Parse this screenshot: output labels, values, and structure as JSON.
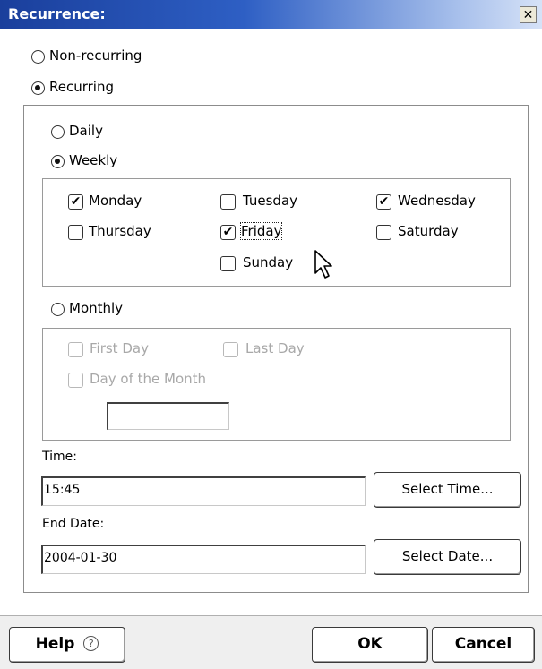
{
  "dialog": {
    "title": "Recurrence:",
    "close_glyph": "✕"
  },
  "recurrence": {
    "non_recurring_label": "Non-recurring",
    "recurring_label": "Recurring",
    "selected": "Recurring"
  },
  "frequency": {
    "daily_label": "Daily",
    "weekly_label": "Weekly",
    "monthly_label": "Monthly",
    "selected": "Weekly"
  },
  "weekly_days": {
    "monday": {
      "label": "Monday",
      "checked": true
    },
    "tuesday": {
      "label": "Tuesday",
      "checked": false
    },
    "wednesday": {
      "label": "Wednesday",
      "checked": true
    },
    "thursday": {
      "label": "Thursday",
      "checked": false
    },
    "friday": {
      "label": "Friday",
      "checked": true
    },
    "saturday": {
      "label": "Saturday",
      "checked": false
    },
    "sunday": {
      "label": "Sunday",
      "checked": false
    }
  },
  "monthly_options": {
    "first_day_label": "First Day",
    "last_day_label": "Last Day",
    "day_of_month_label": "Day of the Month",
    "day_of_month_value": ""
  },
  "time": {
    "label": "Time:",
    "value": "15:45",
    "select_button": "Select Time..."
  },
  "end_date": {
    "label": "End Date:",
    "value": "2004-01-30",
    "select_button": "Select Date..."
  },
  "footer": {
    "help_label": "Help",
    "help_icon": "?",
    "ok_label": "OK",
    "cancel_label": "Cancel"
  },
  "check_glyph": "✔"
}
